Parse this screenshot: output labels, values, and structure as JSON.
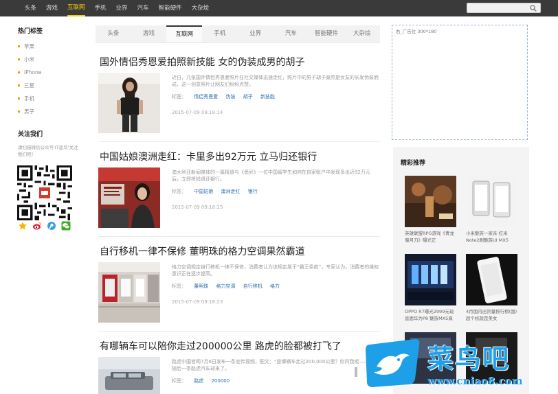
{
  "topnav": [
    "头条",
    "游戏",
    "互联网",
    "手机",
    "业界",
    "汽车",
    "智能硬件",
    "大杂烩"
  ],
  "topnav_active": "互联网",
  "sidebar": {
    "tags_title": "热门标签",
    "tags": [
      "苹果",
      "小米",
      "iPhone",
      "三星",
      "手机",
      "男子"
    ],
    "follow_title": "关注我们",
    "follow_desc": "请扫描微信公众号'IT蓝鸟'关注我们吧！"
  },
  "tabs": [
    "头条",
    "游戏",
    "互联网",
    "手机",
    "业界",
    "汽车",
    "智能硬件",
    "大杂烩"
  ],
  "tabs_active": "互联网",
  "articles": [
    {
      "title": "国外情侣秀恩爱拍照新技能 女的伪装成男的胡子",
      "summary": "近日，几张国外情侣秀恩爱照片在社交媒体迅速走红，照片中的男子胡子竟然是女友的长发伪装而成，这一创意照片让网友们纷纷点赞。",
      "tags_label": "标签：",
      "tags": [
        "情侣秀恩爱",
        "伪装",
        "胡子",
        "新技能"
      ],
      "time": "2015-07-09 09:18:14"
    },
    {
      "title": "中国姑娘澳洲走红：卡里多出92万元 立马归还银行",
      "summary": "澳大利亚新闻媒体的一篇报道与《悉尼》一位中国留学生如何在自家账户中发现多出近92万元后，立即将钱退还银行。",
      "tags_label": "标签：",
      "tags": [
        "中国姑娘",
        "澳洲走红",
        "银行"
      ],
      "time": "2015-07-09 09:18:15"
    },
    {
      "title": "自行移机一律不保修 董明珠的格力空调果然霸道",
      "summary": "格力空调规定自行移机一律不保修，消费者认为该规定属于“霸王条款”，专家认为，消费者的维权意识正在逐步提高。",
      "tags_label": "标签：",
      "tags": [
        "董明珠",
        "格力空调",
        "自行移机",
        "格力"
      ],
      "time": "2015-07-09 09:18:23"
    },
    {
      "title": "有哪辆车可以陪你走过200000公里 路虎的脸都被打飞了",
      "summary": "路虎中国官网7月6日发布一条宣传视频，配文：“是哪辆车走过200,000公里？你问我呢——”，随后一条路虎汽车却来了。",
      "tags_label": "标签：",
      "tags": [
        "路虎",
        "200000"
      ],
      "time": ""
    }
  ],
  "ad_label": "右_广告位 300*180",
  "recommend": {
    "title": "精彩推荐",
    "items": [
      {
        "caption": "英雄联盟RPG游戏《青龙偃月刀》曝光正"
      },
      {
        "caption": "小米魅族一家亲 红米Note2刷魅族UI MX5"
      },
      {
        "caption": "OPPO R7曝光2999元现直面华为P8 魅族MX5真机"
      },
      {
        "caption": "4月国内出货量排行榜(国)超个机就是美女"
      },
      {
        "caption": ""
      },
      {
        "caption": ""
      }
    ]
  },
  "watermark": {
    "text": "菜鸟吧",
    "url": "www.cniao8.com"
  },
  "colors": {
    "topbar": "#3a3a3a",
    "accent": "#f5d000",
    "link": "#2a6fb5",
    "watermark": "#1ea0e8"
  }
}
